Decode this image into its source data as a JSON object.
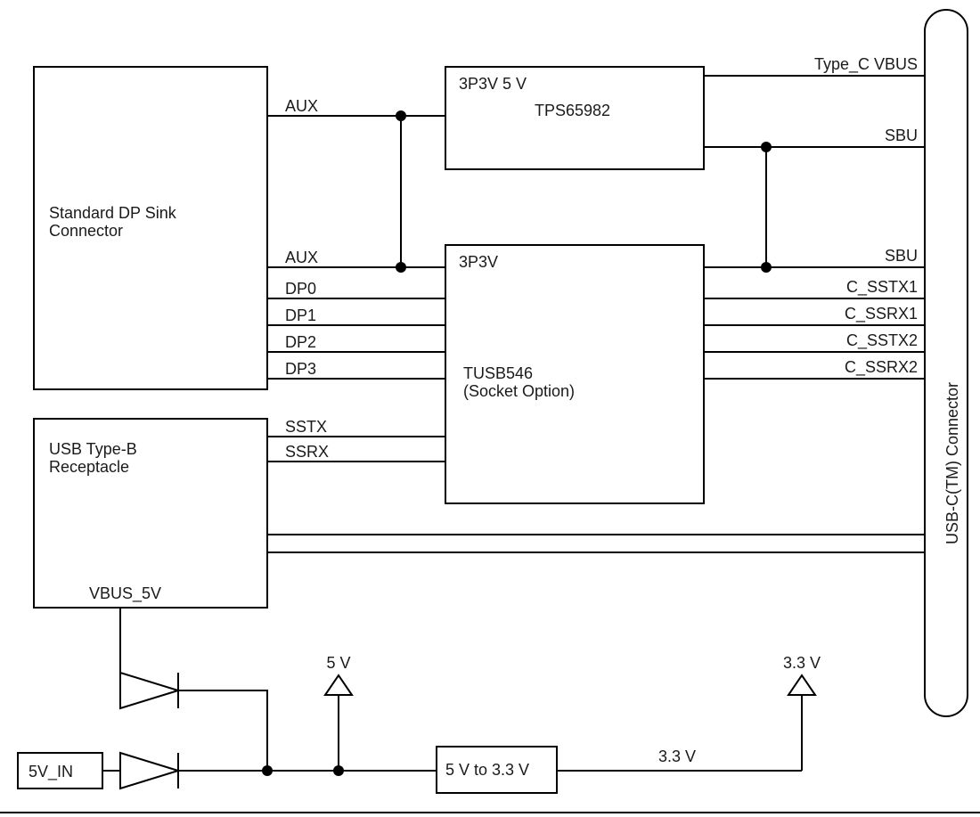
{
  "blocks": {
    "dp_sink_line1": "Standard DP Sink",
    "dp_sink_line2": "Connector",
    "usb_b_line1": "USB Type-B",
    "usb_b_line2": "Receptacle",
    "tps_v": "3P3V  5 V",
    "tps_name": "TPS65982",
    "tusb_v": "3P3V",
    "tusb_name1": "TUSB546",
    "tusb_name2": "(Socket Option)",
    "ldo": "5 V to 3.3 V",
    "in5v": "5V_IN",
    "usbc_conn": "USB-C(TM)  Connector"
  },
  "nets": {
    "aux_top": "AUX",
    "aux_bot": "AUX",
    "dp0": "DP0",
    "dp1": "DP1",
    "dp2": "DP2",
    "dp3": "DP3",
    "sstx": "SSTX",
    "ssrx": "SSRX",
    "vbus5": "VBUS_5V",
    "typec_vbus": "Type_C VBUS",
    "sbu_top": "SBU",
    "sbu_bot": "SBU",
    "csstx1": "C_SSTX1",
    "cssrx1": "C_SSRX1",
    "csstx2": "C_SSTX2",
    "cssrx2": "C_SSRX2",
    "v5": "5 V",
    "v33": "3.3 V",
    "v33_wire": "3.3 V"
  }
}
